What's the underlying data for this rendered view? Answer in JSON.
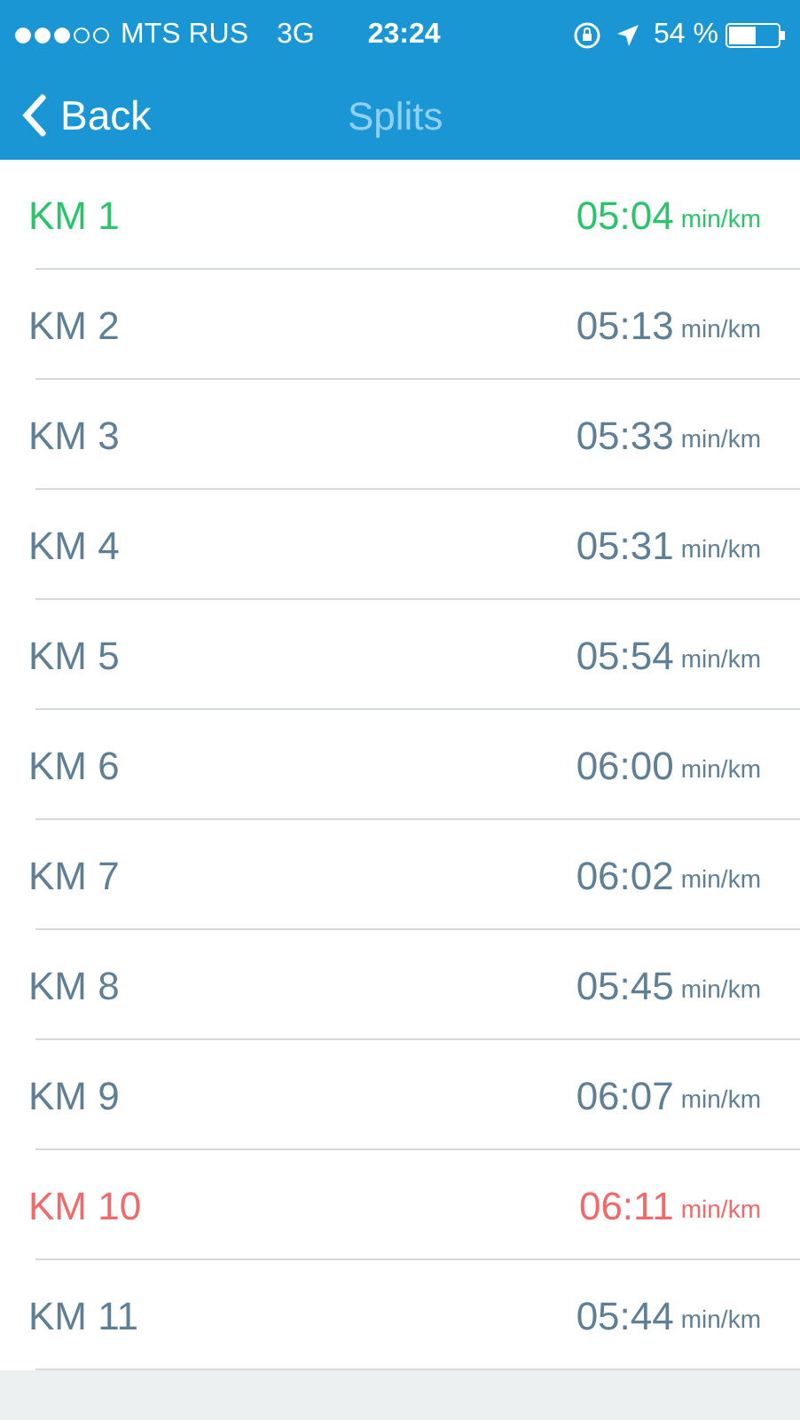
{
  "status_bar": {
    "carrier": "MTS RUS",
    "network": "3G",
    "time": "23:24",
    "battery": "54 %"
  },
  "nav": {
    "back": "Back",
    "title": "Splits"
  },
  "splits": [
    {
      "label": "KM 1",
      "pace": "05:04",
      "unit": "min/km",
      "color": "#2bc46a"
    },
    {
      "label": "KM 2",
      "pace": "05:13",
      "unit": "min/km",
      "color": "#5e7f96"
    },
    {
      "label": "KM 3",
      "pace": "05:33",
      "unit": "min/km",
      "color": "#5e7f96"
    },
    {
      "label": "KM 4",
      "pace": "05:31",
      "unit": "min/km",
      "color": "#5e7f96"
    },
    {
      "label": "KM 5",
      "pace": "05:54",
      "unit": "min/km",
      "color": "#5e7f96"
    },
    {
      "label": "KM 6",
      "pace": "06:00",
      "unit": "min/km",
      "color": "#5e7f96"
    },
    {
      "label": "KM 7",
      "pace": "06:02",
      "unit": "min/km",
      "color": "#5e7f96"
    },
    {
      "label": "KM 8",
      "pace": "05:45",
      "unit": "min/km",
      "color": "#5e7f96"
    },
    {
      "label": "KM 9",
      "pace": "06:07",
      "unit": "min/km",
      "color": "#5e7f96"
    },
    {
      "label": "KM 10",
      "pace": "06:11",
      "unit": "min/km",
      "color": "#f0696b"
    },
    {
      "label": "KM 11",
      "pace": "05:44",
      "unit": "min/km",
      "color": "#5e7f96"
    }
  ]
}
